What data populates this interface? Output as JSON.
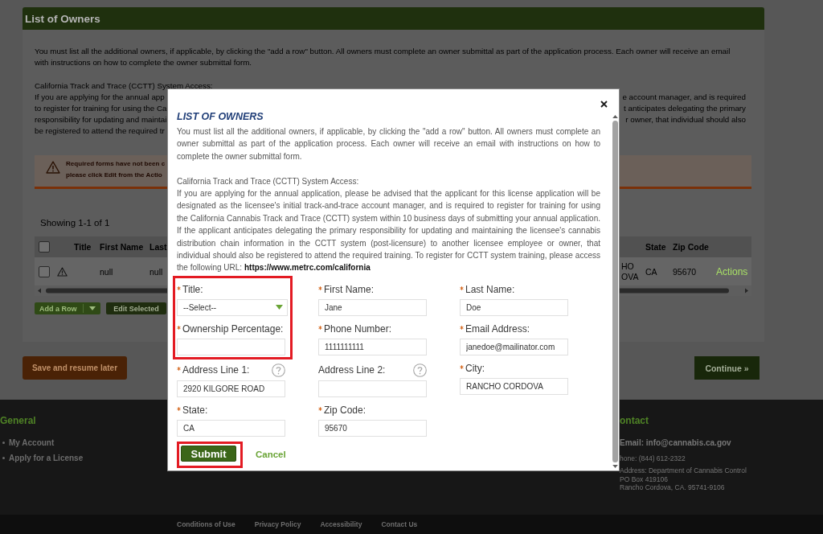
{
  "page": {
    "section_title": "List of Owners",
    "intro": "You must list all the additional owners, if applicable, by clicking the \"add a row\" button. All owners must complete an owner submittal as part of the application process. Each owner will receive an email with instructions on how to complete the owner submittal form.",
    "access_heading": "California Track and Trace (CCTT) System Access:",
    "access_text_left": [
      "If you are applying for the annual app",
      "to register for training for using the Ca",
      "responsibility for updating and maintai",
      "be registered to attend the required tr"
    ],
    "access_text_right": [
      "e account manager, and is required",
      "t anticipates delegating the primary",
      "r owner, that individual should also"
    ],
    "warning_text": "Required forms have not been c\nplease click Edit from the Actio",
    "showing": "Showing 1-1 of 1",
    "table": {
      "all_checked": false,
      "columns_left": [
        "Title",
        "First Name",
        "Last"
      ],
      "columns_right": [
        "State",
        "Zip Code"
      ],
      "rows": [
        {
          "checked": false,
          "warning": true,
          "first_name": "null",
          "last": "null",
          "column_7": "HO\nOVA",
          "state": "CA",
          "zip_code": "95670",
          "action": "Actions"
        }
      ]
    },
    "add_row": "Add a Row",
    "edit_selected": "Edit Selected",
    "save_later": "Save and resume later",
    "continue": "Continue »"
  },
  "footer": {
    "general_heading": "General",
    "general_links": [
      "My Account",
      "Apply for a License"
    ],
    "contact_heading": "ontact",
    "contact_email": "Email: info@cannabis.ca.gov",
    "contact_phone": "hone: (844) 612-2322",
    "contact_address": [
      "Address: Department of Cannabis Control",
      "PO Box 419106",
      "Rancho Cordova, CA. 95741-9106"
    ],
    "bottom_links": [
      "Conditions of Use",
      "Privacy Policy",
      "Accessibility",
      "Contact Us"
    ]
  },
  "dialog": {
    "title": "LIST OF OWNERS",
    "intro": "You must list all the additional owners, if applicable, by clicking the \"add a row\" button. All owners must complete an owner submittal as part of the application process. Each owner will receive an email with instructions on how to complete the owner submittal form.",
    "access_heading": "California Track and Trace (CCTT) System Access:",
    "access_text": "If you are applying for the annual application, please be advised that the applicant for this license application will be designated as the licensee's initial track-and-trace account manager, and is required to register for training for using the California Cannabis Track and Trace (CCTT) system within 10 business days of submitting your annual application. If the applicant anticipates delegating the primary responsibility for updating and maintaining the licensee's cannabis distribution chain information in the CCTT system (post-licensure) to another licensee employee or owner, that individual should also be registered to attend the required training. To register for CCTT system training, please access the following URL: **https://www.metrc.com/california**",
    "form": {
      "rows": [
        [
          {
            "kind": "select",
            "label": "Title:",
            "required": true,
            "help": false,
            "highlighted": true,
            "value": "--Select--"
          },
          {
            "kind": "text",
            "label": "First Name:",
            "required": true,
            "help": false,
            "highlighted": false,
            "value": "Jane"
          },
          {
            "kind": "text",
            "label": "Last Name:",
            "required": true,
            "help": false,
            "highlighted": false,
            "value": "Doe"
          }
        ],
        [
          {
            "kind": "text",
            "label": "Ownership Percentage:",
            "required": true,
            "help": false,
            "highlighted": true
          },
          {
            "kind": "text",
            "label": "Phone Number:",
            "required": true,
            "help": false,
            "highlighted": false,
            "value": "1111111111"
          },
          {
            "kind": "text",
            "label": "Email Address:",
            "required": true,
            "help": false,
            "highlighted": false,
            "value": "janedoe@mailinator.com"
          }
        ],
        [
          {
            "kind": "text",
            "label": "Address Line 1:",
            "required": true,
            "help": true,
            "highlighted": false,
            "value": "2920 KILGORE ROAD"
          },
          {
            "kind": "text",
            "label": "Address Line 2:",
            "required": false,
            "help": true,
            "highlighted": false
          },
          {
            "kind": "text",
            "label": "City:",
            "required": true,
            "help": false,
            "highlighted": false,
            "value": "RANCHO CORDOVA"
          }
        ],
        [
          {
            "kind": "text",
            "label": "State:",
            "required": true,
            "help": false,
            "highlighted": false,
            "value": "CA"
          },
          {
            "kind": "text",
            "label": "Zip Code:",
            "required": true,
            "help": false,
            "highlighted": false,
            "value": "95670"
          }
        ]
      ],
      "submit": {
        "label": "Submit",
        "highlighted": true
      },
      "cancel": "Cancel"
    }
  }
}
